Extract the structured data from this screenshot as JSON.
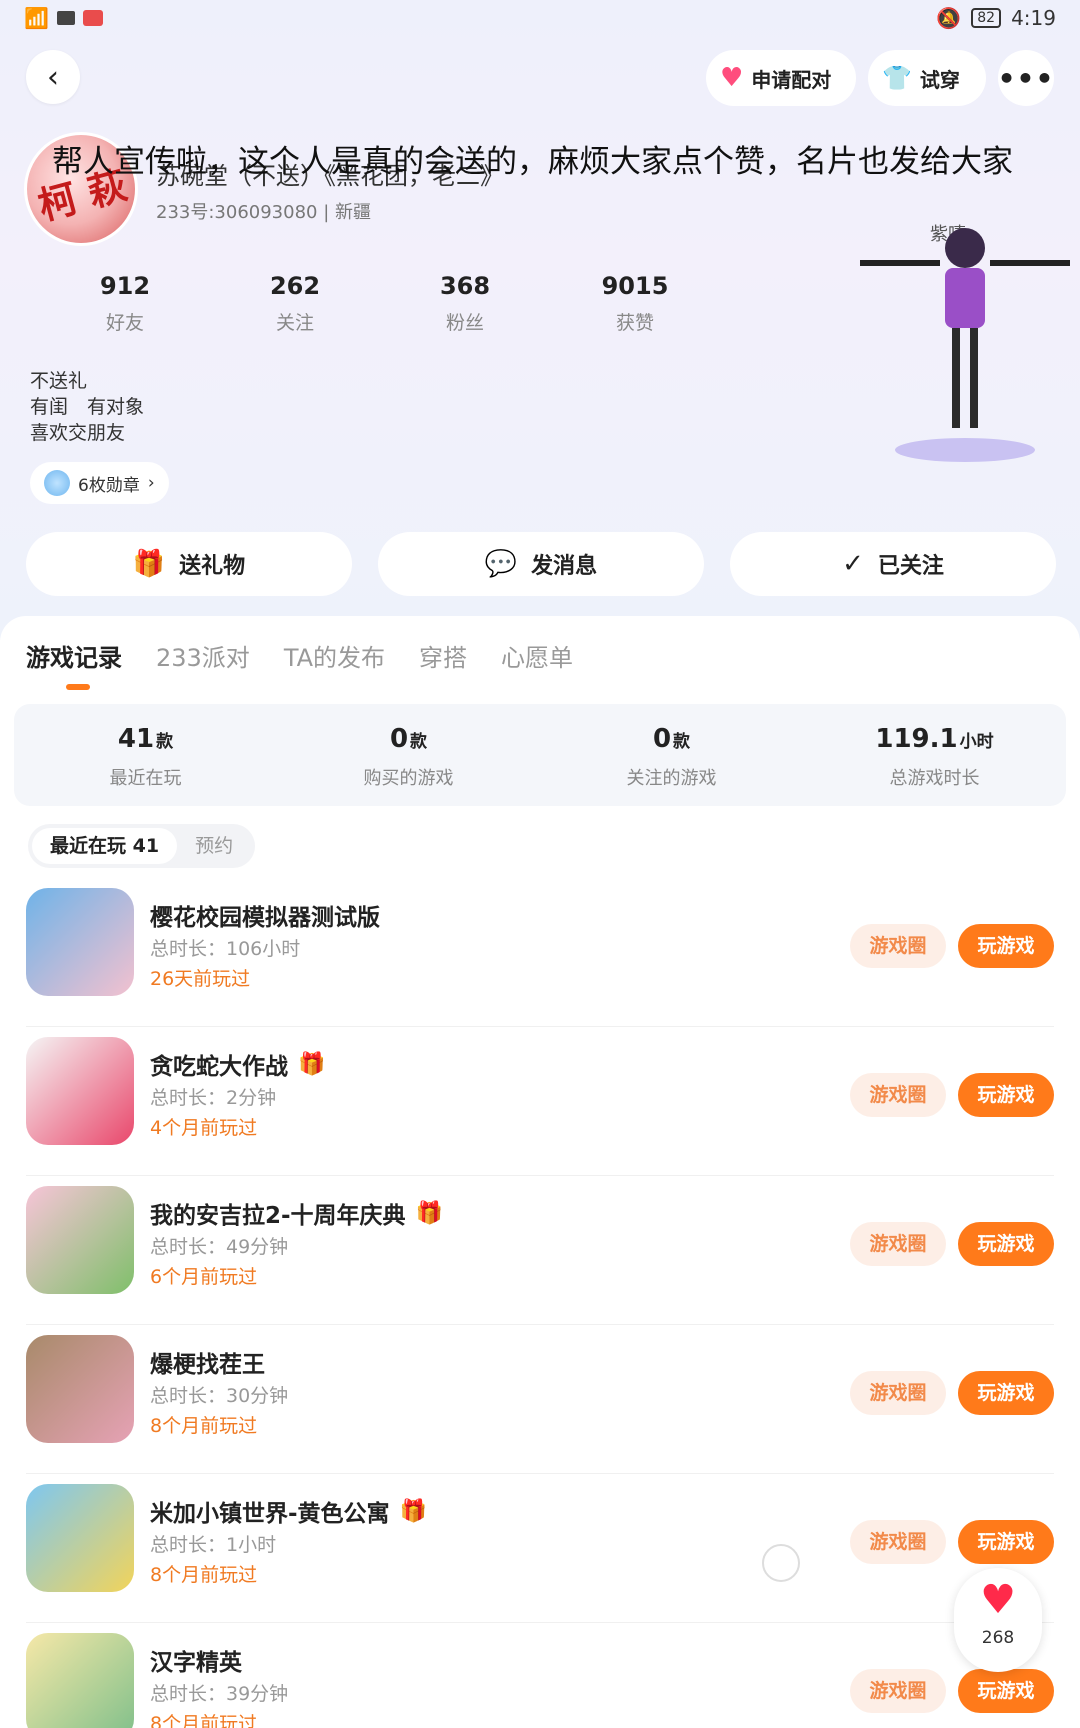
{
  "status_bar": {
    "battery": "82",
    "time": "4:19"
  },
  "header": {
    "match_label": "申请配对",
    "try_on_label": "试穿",
    "more_label": "•••",
    "back_label": "‹"
  },
  "overlay_caption": "帮人宣传啦，这个人是真的会送的，麻烦大家点个赞，名片也发给大家",
  "profile": {
    "name": "苏碗堂（不送）《黑花团，老二》",
    "id_line": "233号:306093080 | 新疆",
    "avatar_mark": "柯 萩",
    "character_tag": "紫嘻",
    "stats": [
      {
        "num": "912",
        "label": "好友"
      },
      {
        "num": "262",
        "label": "关注"
      },
      {
        "num": "368",
        "label": "粉丝"
      },
      {
        "num": "9015",
        "label": "获赞"
      }
    ],
    "bio": [
      "不送礼",
      "有闺　有对象",
      "喜欢交朋友"
    ],
    "badge_label": "6枚勋章",
    "badge_arrow": "›"
  },
  "actions": [
    {
      "icon": "🎁",
      "label": "送礼物"
    },
    {
      "icon": "💬",
      "label": "发消息"
    },
    {
      "icon": "✓",
      "label": "已关注"
    }
  ],
  "tabs": [
    "游戏记录",
    "233派对",
    "TA的发布",
    "穿搭",
    "心愿单"
  ],
  "summary": [
    {
      "num": "41",
      "unit": "款",
      "label": "最近在玩"
    },
    {
      "num": "0",
      "unit": "款",
      "label": "购买的游戏"
    },
    {
      "num": "0",
      "unit": "款",
      "label": "关注的游戏"
    },
    {
      "num": "119.1",
      "unit": "小时",
      "label": "总游戏时长"
    }
  ],
  "filter": {
    "recent": "最近在玩 41",
    "reserve": "预约"
  },
  "game_buttons": {
    "circle": "游戏圈",
    "play": "玩游戏"
  },
  "games": [
    {
      "title": "樱花校园模拟器测试版",
      "duration": "总时长：106小时",
      "last": "26天前玩过",
      "gift": false,
      "colors": [
        "#6fb3e8",
        "#f3c1cf"
      ]
    },
    {
      "title": "贪吃蛇大作战",
      "duration": "总时长：2分钟",
      "last": "4个月前玩过",
      "gift": true,
      "colors": [
        "#f5f5f5",
        "#e9476b"
      ]
    },
    {
      "title": "我的安吉拉2-十周年庆典",
      "duration": "总时长：49分钟",
      "last": "6个月前玩过",
      "gift": true,
      "colors": [
        "#f7c5d8",
        "#7fbf6a"
      ]
    },
    {
      "title": "爆梗找茬王",
      "duration": "总时长：30分钟",
      "last": "8个月前玩过",
      "gift": false,
      "colors": [
        "#a88a6a",
        "#e6a2b5"
      ]
    },
    {
      "title": "米加小镇世界-黄色公寓",
      "duration": "总时长：1小时",
      "last": "8个月前玩过",
      "gift": true,
      "colors": [
        "#7ec7f0",
        "#f2d45a"
      ]
    },
    {
      "title": "汉字精英",
      "duration": "总时长：39分钟",
      "last": "8个月前玩过",
      "gift": false,
      "colors": [
        "#f6e8a8",
        "#7fbf8a"
      ]
    }
  ],
  "like_fab": {
    "count": "268"
  },
  "colors": {
    "accent": "#ff7a1a",
    "accent_soft": "#fdeee6",
    "heart": "#ff4d7d"
  }
}
